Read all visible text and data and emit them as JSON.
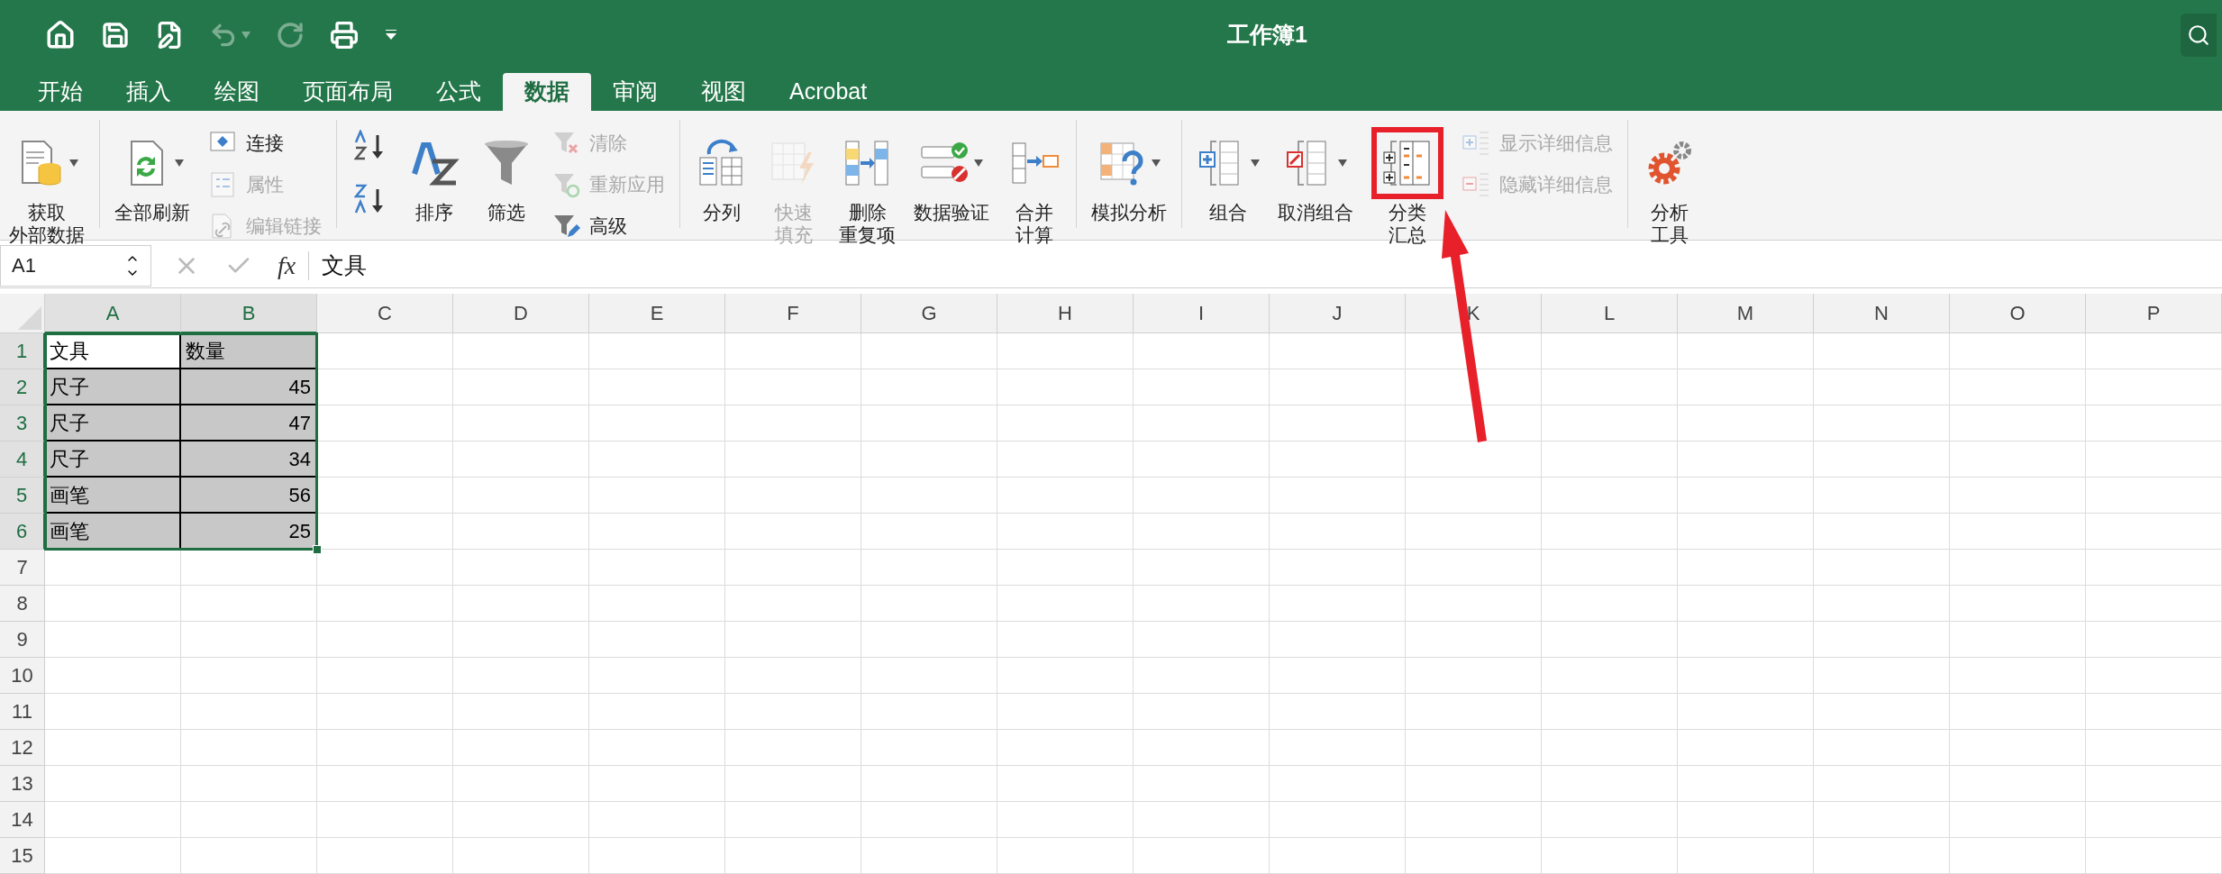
{
  "title_bar": {
    "title": "工作簿1",
    "undo_disabled": true,
    "redo_disabled": true
  },
  "tabs": [
    {
      "label": "开始",
      "selected": false
    },
    {
      "label": "插入",
      "selected": false
    },
    {
      "label": "绘图",
      "selected": false
    },
    {
      "label": "页面布局",
      "selected": false
    },
    {
      "label": "公式",
      "selected": false
    },
    {
      "label": "数据",
      "selected": true
    },
    {
      "label": "审阅",
      "selected": false
    },
    {
      "label": "视图",
      "selected": false
    },
    {
      "label": "Acrobat",
      "selected": false
    }
  ],
  "ribbon": {
    "groups": [
      {
        "items": [
          {
            "kind": "large",
            "lines": [
              "获取",
              "外部数据"
            ],
            "menu": true,
            "disabled": false,
            "highlighted": false
          }
        ]
      },
      {
        "items": [
          {
            "kind": "large",
            "lines": [
              "全部刷新"
            ],
            "menu": true,
            "disabled": false,
            "highlighted": false
          },
          {
            "kind": "stack",
            "rows": [
              {
                "label": "连接",
                "disabled": false
              },
              {
                "label": "属性",
                "disabled": true
              },
              {
                "label": "编辑链接",
                "disabled": true
              }
            ]
          }
        ]
      },
      {
        "items": [
          {
            "kind": "sort"
          },
          {
            "kind": "large",
            "lines": [
              "排序"
            ],
            "menu": false,
            "disabled": false,
            "highlighted": false
          },
          {
            "kind": "large",
            "lines": [
              "筛选"
            ],
            "menu": false,
            "disabled": false,
            "highlighted": false
          },
          {
            "kind": "stack",
            "rows": [
              {
                "label": "清除",
                "disabled": true
              },
              {
                "label": "重新应用",
                "disabled": true
              },
              {
                "label": "高级",
                "disabled": false
              }
            ]
          }
        ]
      },
      {
        "items": [
          {
            "kind": "large",
            "lines": [
              "分列"
            ],
            "menu": false,
            "disabled": false,
            "highlighted": false
          },
          {
            "kind": "large",
            "lines": [
              "快速",
              "填充"
            ],
            "menu": false,
            "disabled": true,
            "highlighted": false
          },
          {
            "kind": "large",
            "lines": [
              "删除",
              "重复项"
            ],
            "menu": false,
            "disabled": false,
            "highlighted": false
          },
          {
            "kind": "large",
            "lines": [
              "数据验证"
            ],
            "menu": true,
            "disabled": false,
            "highlighted": false
          },
          {
            "kind": "large",
            "lines": [
              "合并",
              "计算"
            ],
            "menu": false,
            "disabled": false,
            "highlighted": false
          }
        ]
      },
      {
        "items": [
          {
            "kind": "large",
            "lines": [
              "模拟分析"
            ],
            "menu": true,
            "disabled": false,
            "highlighted": false
          }
        ]
      },
      {
        "items": [
          {
            "kind": "large",
            "lines": [
              "组合"
            ],
            "menu": true,
            "disabled": false,
            "highlighted": false
          },
          {
            "kind": "large",
            "lines": [
              "取消组合"
            ],
            "menu": true,
            "disabled": false,
            "highlighted": false
          },
          {
            "kind": "large",
            "lines": [
              "分类",
              "汇总"
            ],
            "menu": false,
            "disabled": false,
            "highlighted": true
          },
          {
            "kind": "stack",
            "rows": [
              {
                "label": "显示详细信息",
                "disabled": true
              },
              {
                "label": "隐藏详细信息",
                "disabled": true
              }
            ]
          }
        ]
      },
      {
        "items": [
          {
            "kind": "large",
            "lines": [
              "分析",
              "工具"
            ],
            "menu": false,
            "disabled": false,
            "highlighted": false
          }
        ]
      }
    ]
  },
  "formula_bar": {
    "name_box": "A1",
    "fx": "fx",
    "value": "文具"
  },
  "grid": {
    "columns": [
      {
        "label": "A",
        "selected": true
      },
      {
        "label": "B",
        "selected": true
      },
      {
        "label": "C",
        "selected": false
      },
      {
        "label": "D",
        "selected": false
      },
      {
        "label": "E",
        "selected": false
      },
      {
        "label": "F",
        "selected": false
      },
      {
        "label": "G",
        "selected": false
      },
      {
        "label": "H",
        "selected": false
      },
      {
        "label": "I",
        "selected": false
      },
      {
        "label": "J",
        "selected": false
      },
      {
        "label": "K",
        "selected": false
      },
      {
        "label": "L",
        "selected": false
      },
      {
        "label": "M",
        "selected": false
      },
      {
        "label": "N",
        "selected": false
      },
      {
        "label": "O",
        "selected": false
      },
      {
        "label": "P",
        "selected": false
      }
    ],
    "rows": [
      {
        "header": "1",
        "selected": true,
        "cells": [
          {
            "text": "文具",
            "kind": "text",
            "active": true
          },
          {
            "text": "数量",
            "kind": "text",
            "active": false
          }
        ]
      },
      {
        "header": "2",
        "selected": true,
        "cells": [
          {
            "text": "尺子",
            "kind": "text",
            "active": false
          },
          {
            "text": "45",
            "kind": "number",
            "active": false
          }
        ]
      },
      {
        "header": "3",
        "selected": true,
        "cells": [
          {
            "text": "尺子",
            "kind": "text",
            "active": false
          },
          {
            "text": "47",
            "kind": "number",
            "active": false
          }
        ]
      },
      {
        "header": "4",
        "selected": true,
        "cells": [
          {
            "text": "尺子",
            "kind": "text",
            "active": false
          },
          {
            "text": "34",
            "kind": "number",
            "active": false
          }
        ]
      },
      {
        "header": "5",
        "selected": true,
        "cells": [
          {
            "text": "画笔",
            "kind": "text",
            "active": false
          },
          {
            "text": "56",
            "kind": "number",
            "active": false
          }
        ]
      },
      {
        "header": "6",
        "selected": true,
        "cells": [
          {
            "text": "画笔",
            "kind": "text",
            "active": false
          },
          {
            "text": "25",
            "kind": "number",
            "active": false
          }
        ]
      },
      {
        "header": "7",
        "selected": false
      },
      {
        "header": "8",
        "selected": false
      },
      {
        "header": "9",
        "selected": false
      },
      {
        "header": "10",
        "selected": false
      },
      {
        "header": "11",
        "selected": false
      },
      {
        "header": "12",
        "selected": false
      },
      {
        "header": "13",
        "selected": false
      },
      {
        "header": "14",
        "selected": false
      },
      {
        "header": "15",
        "selected": false
      }
    ]
  }
}
